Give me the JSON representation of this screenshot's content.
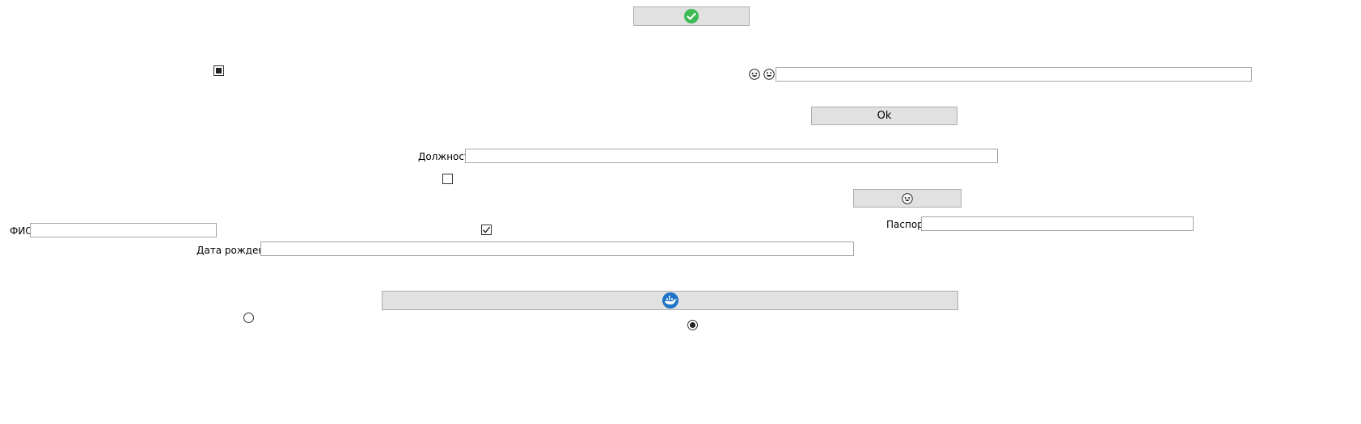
{
  "buttons": {
    "top_check_icon": "check-circle-icon",
    "ok_label": "Ok",
    "emoji_icon": "laughing-face-icon",
    "wide_icon": "whale-icon"
  },
  "fields": {
    "dolzhnost_label": "Должность",
    "fio_label": "ФИО",
    "pasport_label": "Паспорт",
    "data_rozhdeniya_label": "Дата рождения"
  },
  "checkboxes": {
    "small_box_state": "indeterminate",
    "empty_box_state": "unchecked",
    "checked_box_state": "checked"
  },
  "radios": {
    "left_state": "unselected",
    "right_state": "selected"
  },
  "colors": {
    "button_bg": "#e1e1e1",
    "button_border": "#adadad",
    "check_icon_green": "#3cba54",
    "whale_icon_blue": "#1e74c8"
  }
}
